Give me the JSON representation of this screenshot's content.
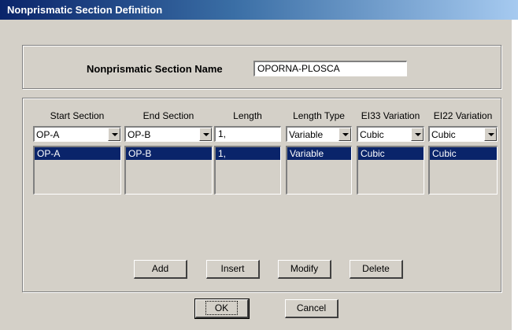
{
  "window": {
    "title": "Nonprismatic Section Definition"
  },
  "name_section": {
    "label": "Nonprismatic Section Name",
    "value": "OPORNA-PLOSCA"
  },
  "table": {
    "headers": {
      "start_section": "Start Section",
      "end_section": "End Section",
      "length": "Length",
      "length_type": "Length Type",
      "ei33": "EI33 Variation",
      "ei22": "EI22 Variation"
    },
    "edit_row": {
      "start_section": "OP-A",
      "end_section": "OP-B",
      "length": "1,",
      "length_type": "Variable",
      "ei33": "Cubic",
      "ei22": "Cubic"
    },
    "list_row": {
      "start_section": "OP-A",
      "end_section": "OP-B",
      "length": "1,",
      "length_type": "Variable",
      "ei33": "Cubic",
      "ei22": "Cubic"
    }
  },
  "buttons": {
    "add": "Add",
    "insert": "Insert",
    "modify": "Modify",
    "delete": "Delete",
    "ok": "OK",
    "cancel": "Cancel"
  },
  "colors": {
    "dialog_bg": "#d4d0c8",
    "selection": "#0a246a",
    "title_start": "#0a246a",
    "title_end": "#a6caf0"
  }
}
